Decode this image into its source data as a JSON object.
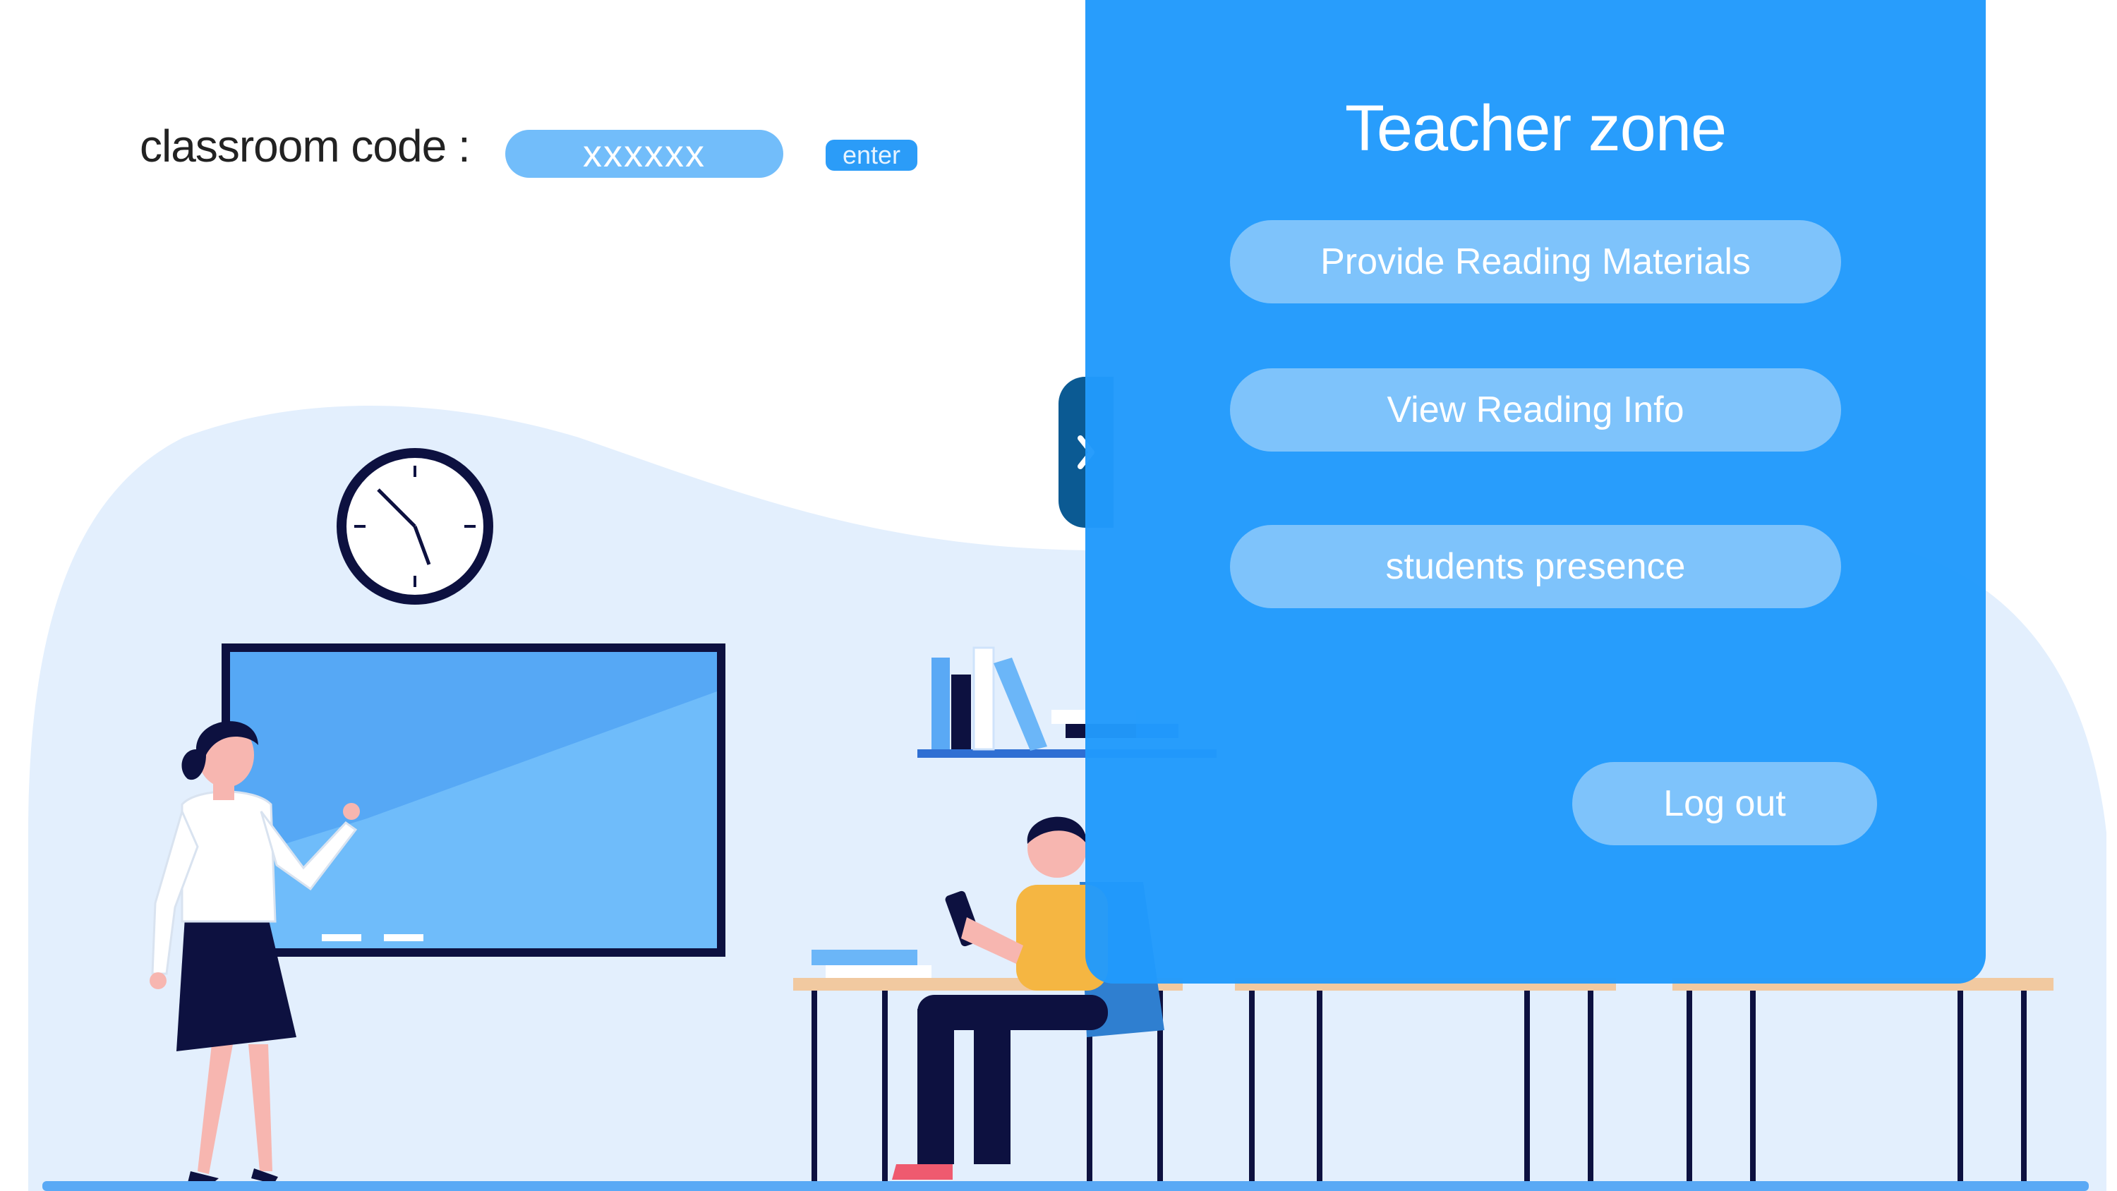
{
  "classroom": {
    "label": "classroom code :",
    "code_value": "xxxxxx",
    "enter_label": "enter"
  },
  "teacher_zone": {
    "title": "Teacher zone",
    "collapse_icon": "chevron-right-icon",
    "buttons": [
      {
        "label": "Provide Reading Materials"
      },
      {
        "label": "View Reading Info"
      },
      {
        "label": "students presence"
      }
    ],
    "logout_label": "Log out"
  },
  "colors": {
    "panel": "#219afc",
    "button": "#7ec3fb",
    "input": "#72bdfa",
    "background_blob": "#e3effd",
    "tab": "#0b5a93"
  }
}
